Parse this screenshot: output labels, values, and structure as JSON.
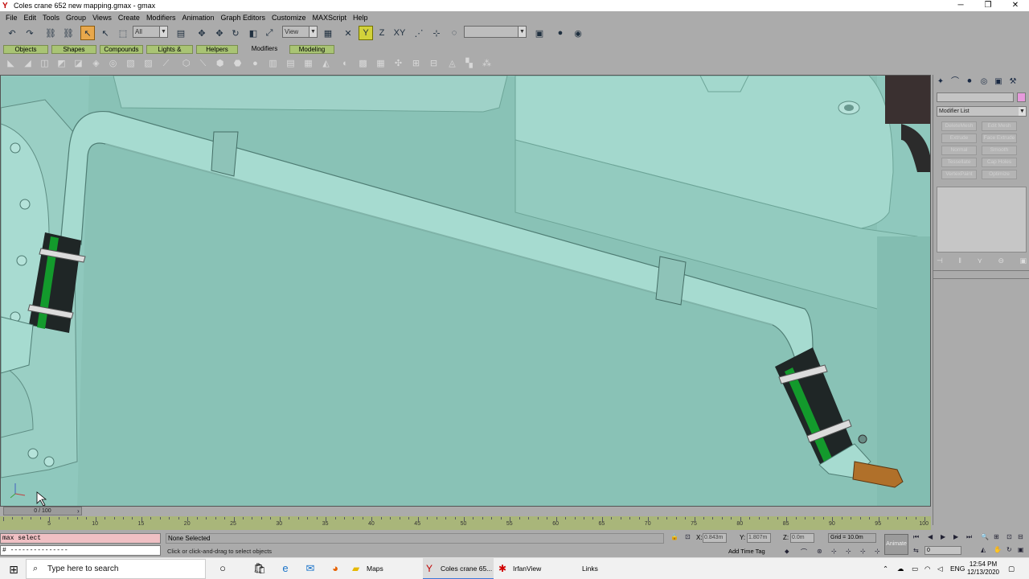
{
  "window": {
    "title": "Coles crane 652 new mapping.gmax - gmax",
    "controls": [
      "─",
      "❐",
      "✕"
    ]
  },
  "menu": [
    "File",
    "Edit",
    "Tools",
    "Group",
    "Views",
    "Create",
    "Modifiers",
    "Animation",
    "Graph Editors",
    "Customize",
    "MAXScript",
    "Help"
  ],
  "toolbar": {
    "selection_filter": "All",
    "coord_system": "View",
    "named_selection": ""
  },
  "tabs": [
    {
      "label": "Objects"
    },
    {
      "label": "Shapes"
    },
    {
      "label": "Compounds"
    },
    {
      "label": "Lights & Cameras"
    },
    {
      "label": "Helpers"
    },
    {
      "label": "Modifiers"
    },
    {
      "label": "Modeling"
    }
  ],
  "command_panel": {
    "modifier_list_label": "Modifier List",
    "modifier_buttons": [
      "DeleteMesh",
      "Edit Mesh",
      "Extrude",
      "Face Extrude",
      "Normal",
      "Smooth",
      "Tessellate",
      "Cap Holes",
      "VertexPaint",
      "Optimize"
    ],
    "swatch_color": "#e69adc"
  },
  "timeline": {
    "slider_label": "0 / 100",
    "ticks": [
      "5",
      "10",
      "15",
      "20",
      "25",
      "30",
      "35",
      "40",
      "45",
      "50",
      "55",
      "60",
      "65",
      "70",
      "75",
      "80",
      "85",
      "90",
      "95",
      "100"
    ]
  },
  "status": {
    "maxscript_line1": "max select",
    "maxscript_line2": "# ---------------",
    "selection_text": "None Selected",
    "prompt_text": "Click or click-and-drag to select objects",
    "x_label": "X:",
    "x_value": "0.843m",
    "y_label": "Y:",
    "y_value": "1.807m",
    "z_label": "Z:",
    "z_value": "0.0m",
    "grid_text": "Grid = 10.0m",
    "add_time_tag": "Add Time Tag",
    "animate_label": "Animate",
    "frame_value": "0"
  },
  "taskbar": {
    "search_placeholder": "Type here to search",
    "items": [
      {
        "label": "Maps"
      },
      {
        "label": "Coles crane 65..."
      },
      {
        "label": "IrfanView"
      },
      {
        "label": "Links"
      }
    ],
    "language": "ENG",
    "time": "12:54 PM",
    "date": "12/13/2020"
  },
  "colors": {
    "viewport_background": "#8fc8bd",
    "trackbar": "#a9b67a",
    "tab_green": "#a9c474",
    "active_tool": "#e8a84c"
  }
}
